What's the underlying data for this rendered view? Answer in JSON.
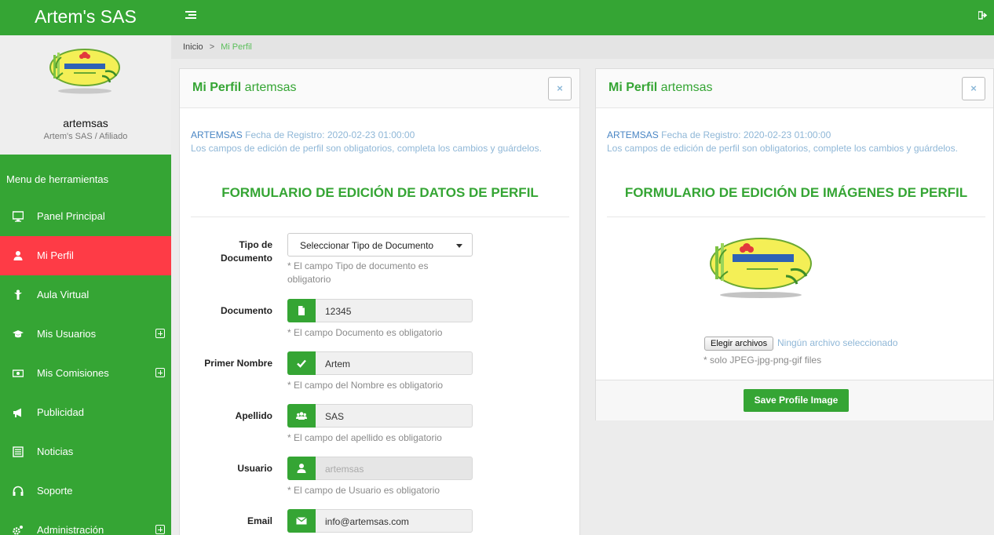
{
  "app": {
    "brand": "Artem's SAS"
  },
  "sidebar": {
    "user_name": "artemsas",
    "user_role": "Artem's SAS / Afiliado",
    "menu_title": "Menu de herramientas",
    "items": [
      {
        "label": "Panel Principal",
        "icon": "monitor-icon",
        "expandable": false,
        "active": false
      },
      {
        "label": "Mi Perfil",
        "icon": "user-icon",
        "expandable": false,
        "active": true
      },
      {
        "label": "Aula Virtual",
        "icon": "person-icon",
        "expandable": false,
        "active": false
      },
      {
        "label": "Mis Usuarios",
        "icon": "graduation-cap-icon",
        "expandable": true,
        "active": false
      },
      {
        "label": "Mis Comisiones",
        "icon": "money-icon",
        "expandable": true,
        "active": false
      },
      {
        "label": "Publicidad",
        "icon": "megaphone-icon",
        "expandable": false,
        "active": false
      },
      {
        "label": "Noticias",
        "icon": "newspaper-icon",
        "expandable": false,
        "active": false
      },
      {
        "label": "Soporte",
        "icon": "headphones-icon",
        "expandable": false,
        "active": false
      },
      {
        "label": "Administración",
        "icon": "cogs-icon",
        "expandable": true,
        "active": false
      }
    ]
  },
  "breadcrumb": {
    "home": "Inicio",
    "separator": ">",
    "current": "Mi Perfil"
  },
  "left_panel": {
    "title_bold": "Mi Perfil",
    "title_rest": " artemsas",
    "close": "×",
    "username": "ARTEMSAS",
    "registration": " Fecha de Registro: 2020-02-23 01:00:00",
    "notice": "Los campos de edición de perfil son obligatorios, completa los cambios y guárdelos.",
    "form_title": "FORMULARIO DE EDICIÓN DE DATOS DE PERFIL",
    "fields": {
      "doc_type": {
        "label": "Tipo de Documento",
        "value": "Seleccionar Tipo de Documento",
        "help": "* El campo Tipo de documento es obligatorio"
      },
      "document": {
        "label": "Documento",
        "value": "12345",
        "help": "* El campo Documento es obligatorio",
        "icon": "file-icon"
      },
      "first_name": {
        "label": "Primer Nombre",
        "value": "Artem",
        "help": "* El campo del Nombre es obligatorio",
        "icon": "check-icon"
      },
      "last_name": {
        "label": "Apellido",
        "value": "SAS",
        "help": "* El campo del apellido es obligatorio",
        "icon": "users-icon"
      },
      "username": {
        "label": "Usuario",
        "value": "artemsas",
        "help": "* El campo de Usuario es obligatorio",
        "icon": "user-icon"
      },
      "email": {
        "label": "Email",
        "value": "info@artemsas.com",
        "icon": "envelope-icon"
      }
    }
  },
  "right_panel": {
    "title_bold": "Mi Perfil",
    "title_rest": " artemsas",
    "close": "×",
    "username": "ARTEMSAS",
    "registration": " Fecha de Registro: 2020-02-23 01:00:00",
    "notice": "Los campos de edición de perfil son obligatorios, complete los cambios y guárdelos.",
    "form_title": "FORMULARIO DE EDICIÓN DE IMÁGENES DE PERFIL",
    "file_button": "Elegir archivos",
    "file_status": "Ningún archivo seleccionado",
    "file_help": "* solo JPEG-jpg-png-gif files",
    "save_button": "Save Profile Image"
  },
  "colors": {
    "brand_green": "#35a534",
    "active_red": "#fe3b46",
    "link_blue": "#8fb7d7"
  }
}
